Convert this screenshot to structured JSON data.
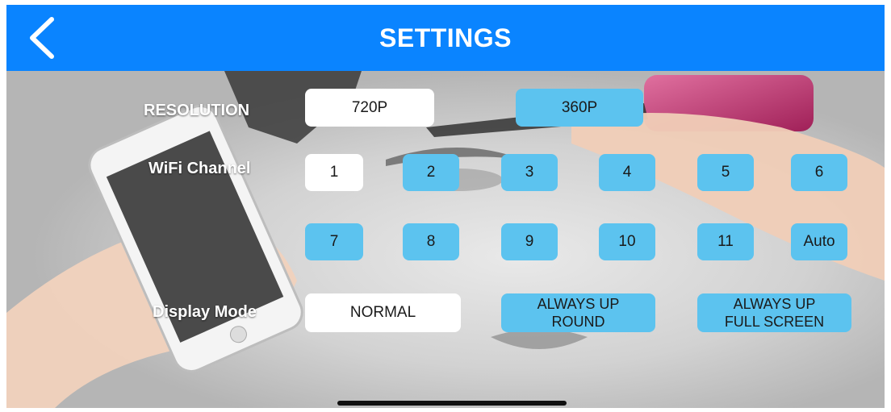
{
  "header": {
    "title": "SETTINGS",
    "back_icon": "chevron-left-icon",
    "background_color": "#0a84ff"
  },
  "resolution": {
    "label": "RESOLUTION",
    "options": [
      "720P",
      "360P"
    ],
    "selected": "720P"
  },
  "wifi": {
    "label": "WiFi Channel",
    "row1": [
      "1",
      "2",
      "3",
      "4",
      "5",
      "6"
    ],
    "row2": [
      "7",
      "8",
      "9",
      "10",
      "11",
      "Auto"
    ],
    "selected": "1"
  },
  "display_mode": {
    "label": "Display Mode",
    "normal": "NORMAL",
    "round": {
      "line1": "ALWAYS UP",
      "line2": "ROUND"
    },
    "fullscreen": {
      "line1": "ALWAYS UP",
      "line2": "FULL SCREEN"
    },
    "selected": "NORMAL"
  },
  "colors": {
    "selected_button": "#ffffff",
    "unselected_button": "#5cc3ef"
  }
}
